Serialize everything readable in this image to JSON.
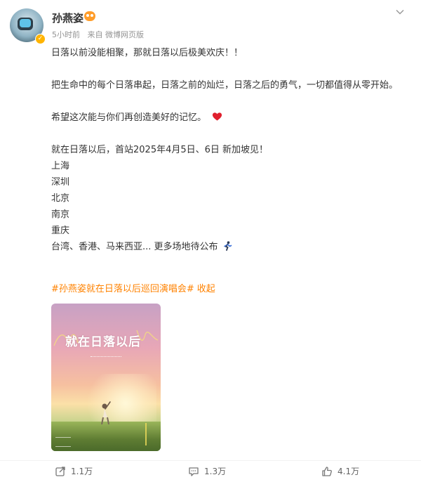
{
  "post": {
    "username": "孙燕姿",
    "time": "5小时前",
    "source": "来自 微博网页版",
    "paragraphs": {
      "p1": "日落以前没能相聚，那就日落以后极美欢庆！！",
      "p2": "把生命中的每个日落串起，日落之前的灿烂，日落之后的勇气，一切都值得从零开始。",
      "p3": "希望这次能与你们再创造美好的记忆。",
      "p4": "就在日落以后，首站2025年4月5日、6日 新加坡见！"
    },
    "cities": [
      "上海",
      "深圳",
      "北京",
      "南京",
      "重庆"
    ],
    "more_line": "台湾、香港、马来西亚... 更多场地待公布",
    "topic": "#孙燕姿就在日落以后巡回演唱会#",
    "collapse": "收起",
    "poster_title": "就在日落以后"
  },
  "actions": {
    "repost": "1.1万",
    "comment": "1.3万",
    "like": "4.1万"
  },
  "icons": {
    "heart": "heart-icon",
    "runner": "running-person-icon",
    "repost": "repost-icon",
    "comment": "comment-icon",
    "like": "thumbs-up-icon",
    "more": "chevron-down-icon"
  },
  "colors": {
    "accent": "#ff8200",
    "heart": "#e0202e",
    "text": "#333333",
    "muted": "#939393"
  }
}
